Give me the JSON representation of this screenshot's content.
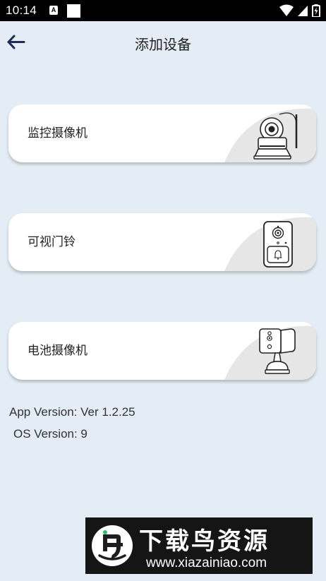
{
  "status_bar": {
    "time": "10:14",
    "notification_icon": "A",
    "icons": [
      "wifi-icon",
      "signal-icon",
      "battery-icon"
    ]
  },
  "app_bar": {
    "back_icon": "arrow-left-icon",
    "title": "添加设备"
  },
  "devices": [
    {
      "label": "监控摄像机",
      "icon": "ptz-camera-icon"
    },
    {
      "label": "可视门铃",
      "icon": "doorbell-icon"
    },
    {
      "label": "电池摄像机",
      "icon": "battery-camera-icon"
    }
  ],
  "version_info": {
    "app_version": "App Version: Ver 1.2.25",
    "os_version": "OS Version: 9"
  },
  "watermark": {
    "title": "下载鸟资源",
    "url": "www.xiazainiao.com"
  },
  "colors": {
    "background": "#e4edf5",
    "card": "#ffffff",
    "card_accent": "#e6e6e6",
    "back_arrow": "#1c2a5c"
  }
}
